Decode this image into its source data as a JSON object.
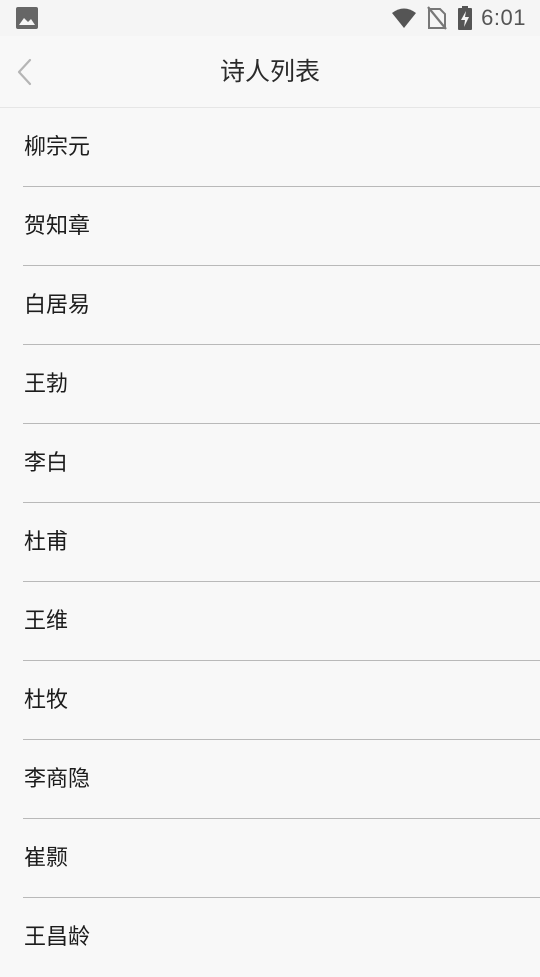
{
  "status_bar": {
    "time": "6:01",
    "icons": [
      "image-icon",
      "wifi-icon",
      "no-sim-icon",
      "battery-charging-icon"
    ]
  },
  "toolbar": {
    "back_icon": "chevron-left-icon",
    "title": "诗人列表"
  },
  "poets": [
    "柳宗元",
    "贺知章",
    "白居易",
    "王勃",
    "李白",
    "杜甫",
    "王维",
    "杜牧",
    "李商隐",
    "崔颢",
    "王昌龄"
  ]
}
